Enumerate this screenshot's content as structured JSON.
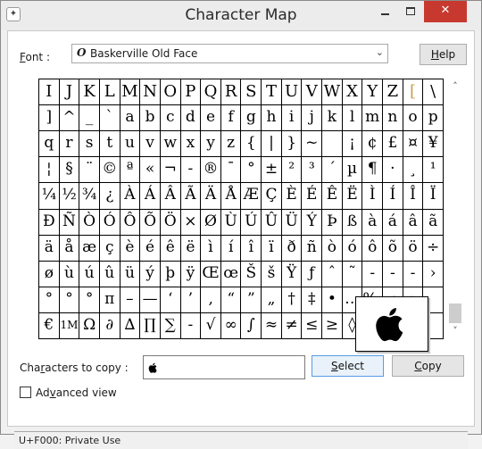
{
  "window": {
    "title": "Character Map",
    "app_icon_glyph": "✦",
    "minimize_icon": "minimize-icon",
    "maximize_icon": "maximize-icon",
    "close_glyph": "✕"
  },
  "font": {
    "label_underlined": "F",
    "label_rest": "ont :",
    "icon_glyph": "O",
    "selected": "Baskerville Old Face",
    "dropdown_glyph": "⌄"
  },
  "buttons": {
    "help_underlined": "H",
    "help_rest": "elp",
    "select_underlined": "S",
    "select_rest": "elect",
    "copy_underlined": "C",
    "copy_rest": "opy"
  },
  "grid_rows": [
    [
      "I",
      "J",
      "K",
      "L",
      "M",
      "N",
      "O",
      "P",
      "Q",
      "R",
      "S",
      "T",
      "U",
      "V",
      "W",
      "X",
      "Y",
      "Z",
      "[",
      "\\"
    ],
    [
      "]",
      "^",
      "_",
      "`",
      "a",
      "b",
      "c",
      "d",
      "e",
      "f",
      "g",
      "h",
      "i",
      "j",
      "k",
      "l",
      "m",
      "n",
      "o",
      "p"
    ],
    [
      "q",
      "r",
      "s",
      "t",
      "u",
      "v",
      "w",
      "x",
      "y",
      "z",
      "{",
      "|",
      "}",
      "~",
      "",
      "¡",
      "¢",
      "£",
      "¤",
      "¥"
    ],
    [
      "¦",
      "§",
      "¨",
      "©",
      "ª",
      "«",
      "¬",
      "-",
      "®",
      "¯",
      "°",
      "±",
      "²",
      "³",
      "´",
      "µ",
      "¶",
      "·",
      "¸",
      "¹"
    ],
    [
      "¼",
      "½",
      "¾",
      "¿",
      "À",
      "Á",
      "Â",
      "Ã",
      "Ä",
      "Å",
      "Æ",
      "Ç",
      "È",
      "É",
      "Ê",
      "Ë",
      "Ì",
      "Í",
      "Î",
      "Ï"
    ],
    [
      "Ð",
      "Ñ",
      "Ò",
      "Ó",
      "Ô",
      "Õ",
      "Ö",
      "×",
      "Ø",
      "Ù",
      "Ú",
      "Û",
      "Ü",
      "Ý",
      "Þ",
      "ß",
      "à",
      "á",
      "â",
      "ã"
    ],
    [
      "ä",
      "å",
      "æ",
      "ç",
      "è",
      "é",
      "ê",
      "ë",
      "ì",
      "í",
      "î",
      "ï",
      "ð",
      "ñ",
      "ò",
      "ó",
      "ô",
      "õ",
      "ö",
      "÷"
    ],
    [
      "ø",
      "ù",
      "ú",
      "û",
      "ü",
      "ý",
      "þ",
      "ÿ",
      "Œ",
      "œ",
      "Š",
      "š",
      "Ÿ",
      "ƒ",
      "ˆ",
      "˜",
      "-",
      "-",
      "-",
      "›"
    ],
    [
      "°",
      "°",
      "°",
      "π",
      "–",
      "—",
      "‘",
      "’",
      "‚",
      "“",
      "”",
      "„",
      "†",
      "‡",
      "•",
      "…",
      "‰",
      "‹",
      "›",
      ""
    ],
    [
      "€",
      "1M",
      "Ω",
      "∂",
      "∆",
      "∏",
      "∑",
      "-",
      "√",
      "∞",
      "∫",
      "≈",
      "≠",
      "≤",
      "≥",
      "◊",
      "",
      "",
      "",
      ""
    ]
  ],
  "magnifier": {
    "char": "",
    "icon": "apple-logo-icon"
  },
  "copy": {
    "label_pre": "Cha",
    "label_underlined": "r",
    "label_post": "acters to copy :",
    "value": ""
  },
  "advanced": {
    "label_underlined": "v",
    "label_pre": "Ad",
    "label_post": "anced view",
    "checked": false
  },
  "status": {
    "text": "U+F000: Private Use"
  },
  "scroll": {
    "up_glyph": "˄",
    "down_glyph": "˅"
  }
}
